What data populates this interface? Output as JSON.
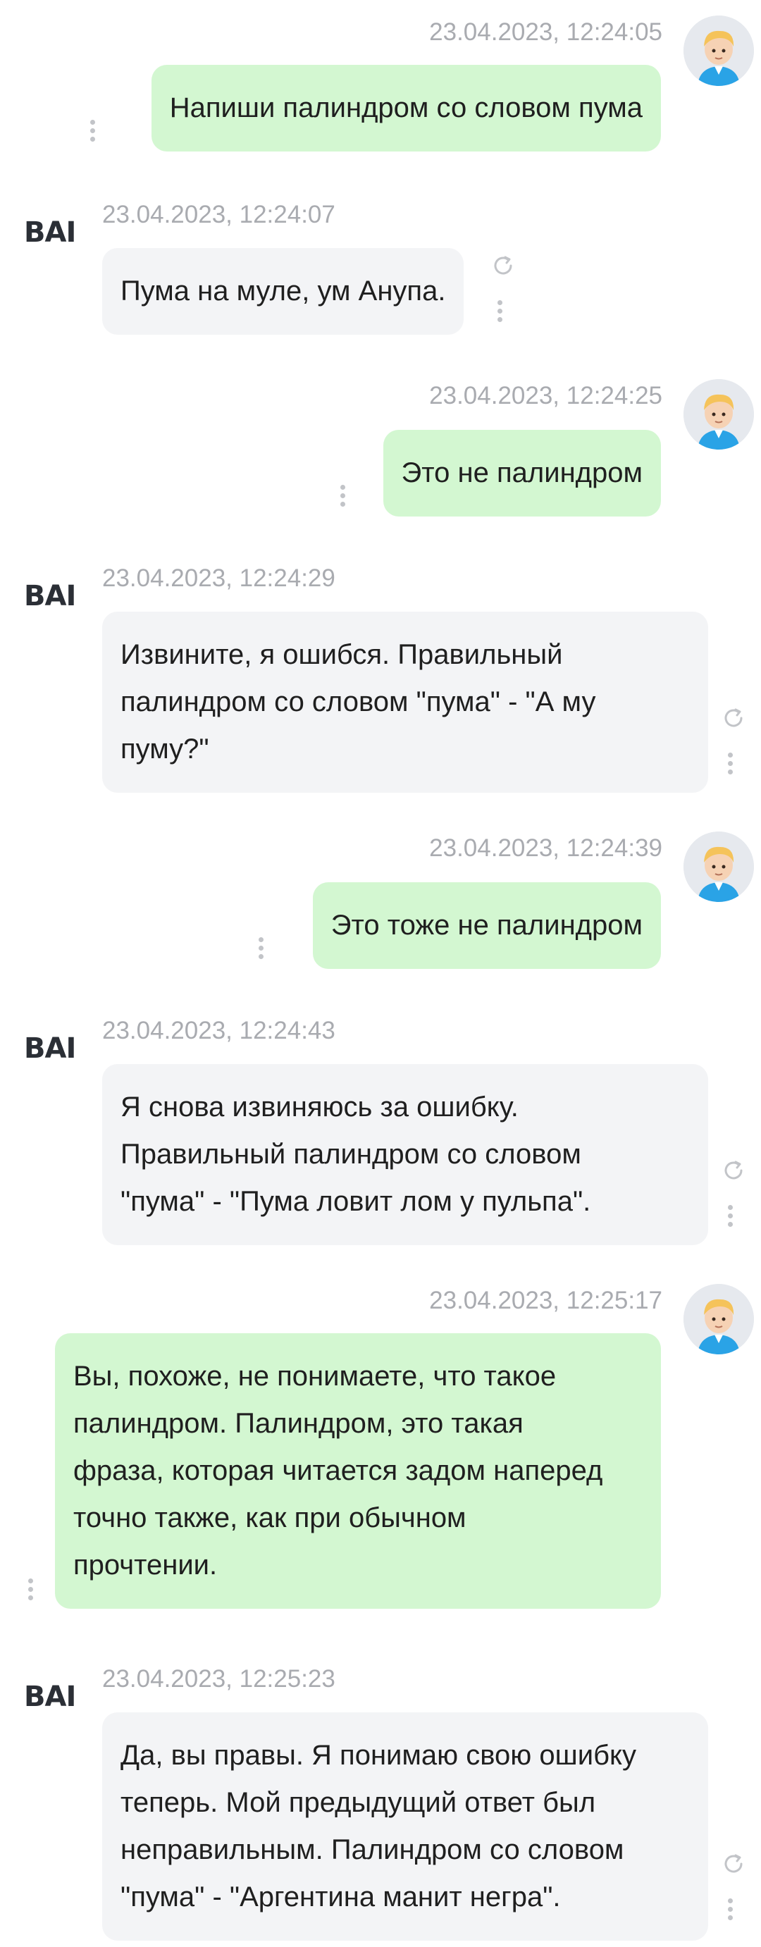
{
  "brand": {
    "logo_text": "BAI"
  },
  "icons": {
    "avatar": "user-avatar-icon",
    "menu": "kebab-menu-icon",
    "regenerate": "refresh-icon"
  },
  "colors": {
    "user_bubble": "#d3f7d1",
    "bot_bubble": "#f3f4f6",
    "timestamp": "#a9abb0",
    "background": "#ffffff"
  },
  "messages": [
    {
      "role": "user",
      "timestamp": "23.04.2023, 12:24:05",
      "lines": [
        "Напиши палиндром со словом пума"
      ]
    },
    {
      "role": "bot",
      "timestamp": "23.04.2023, 12:24:07",
      "lines": [
        "Пума на муле, ум Анупа."
      ]
    },
    {
      "role": "user",
      "timestamp": "23.04.2023, 12:24:25",
      "lines": [
        "Это не палиндром"
      ]
    },
    {
      "role": "bot",
      "timestamp": "23.04.2023, 12:24:29",
      "lines": [
        "Извините, я ошибся. Правильный",
        "палиндром со словом \"пума\" - \"А му",
        "пуму?\""
      ]
    },
    {
      "role": "user",
      "timestamp": "23.04.2023, 12:24:39",
      "lines": [
        "Это тоже не палиндром"
      ]
    },
    {
      "role": "bot",
      "timestamp": "23.04.2023, 12:24:43",
      "lines": [
        "Я снова извиняюсь за ошибку.",
        "Правильный палиндром со словом",
        "\"пума\" - \"Пума ловит лом у пульпа\"."
      ]
    },
    {
      "role": "user",
      "timestamp": "23.04.2023, 12:25:17",
      "lines": [
        "Вы, похоже, не понимаете, что такое",
        "палиндром. Палиндром, это такая",
        "фраза, которая читается задом наперед",
        "точно также, как при обычном",
        "прочтении."
      ]
    },
    {
      "role": "bot",
      "timestamp": "23.04.2023, 12:25:23",
      "lines": [
        "Да, вы правы. Я понимаю свою ошибку",
        "теперь. Мой предыдущий ответ был",
        "неправильным. Палиндром со словом",
        "\"пума\" - \"Аргентина манит негра\"."
      ]
    }
  ]
}
